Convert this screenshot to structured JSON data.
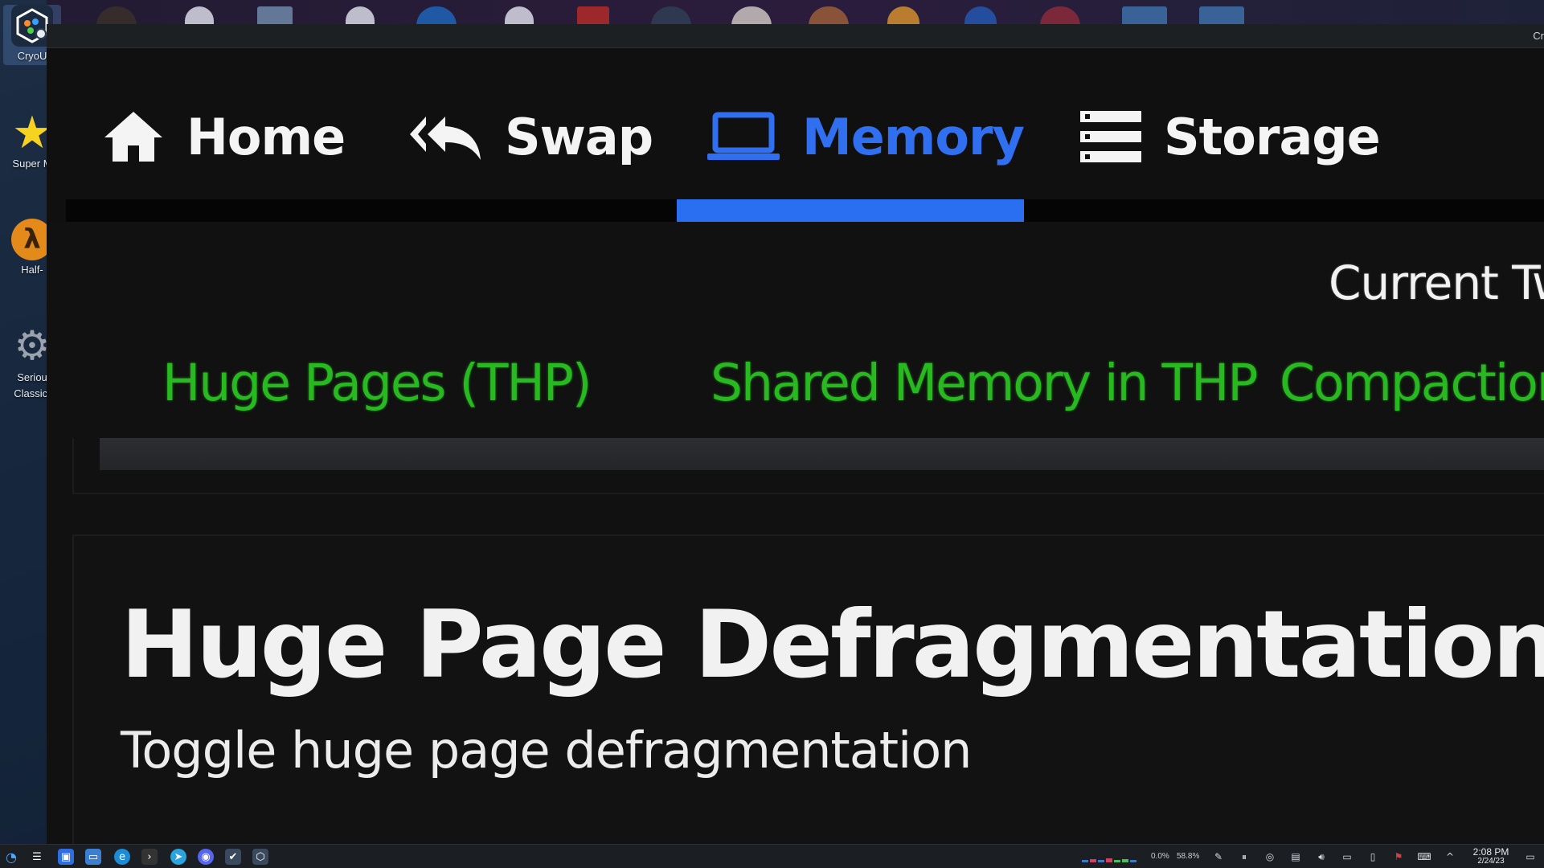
{
  "desktop": {
    "icons": [
      {
        "name": "CryoUtilities",
        "label": "CryoU",
        "icon": "cryo-hex-icon"
      },
      {
        "name": "Super Mario",
        "label": "Super M",
        "icon": "star-icon"
      },
      {
        "name": "Half-Life",
        "label": "Half-",
        "icon": "lambda-icon"
      },
      {
        "name": "Serious Sam Classic",
        "label": "Seriou\nClassic:",
        "icon": "gear-logo-icon"
      }
    ]
  },
  "window": {
    "title": "Cr"
  },
  "nav": {
    "tabs": [
      {
        "label": "Home",
        "icon": "home-icon"
      },
      {
        "label": "Swap",
        "icon": "reply-all-icon"
      },
      {
        "label": "Memory",
        "icon": "laptop-icon"
      },
      {
        "label": "Storage",
        "icon": "server-list-icon"
      }
    ],
    "active_tab": "Memory"
  },
  "memory_page": {
    "current_header": "Current Tw",
    "toggles": [
      "Huge Pages (THP)",
      "Shared Memory in THP",
      "Compaction"
    ],
    "card": {
      "title": "Huge Page Defragmentation",
      "description": "Toggle huge page defragmentation"
    }
  },
  "taskbar": {
    "cpu_text": "0.0%",
    "mem_text": "58.8%",
    "time": "2:08 PM",
    "date": "2/24/23"
  },
  "colors": {
    "accent": "#2a6ef1",
    "toggle_green": "#27b91f",
    "background": "#111111"
  }
}
